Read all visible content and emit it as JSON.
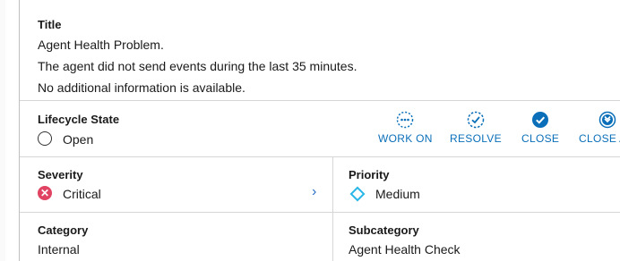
{
  "title_section": {
    "label": "Title",
    "lines": [
      "Agent Health Problem.",
      "The agent did not send events during the last 35 minutes.",
      "No additional information is available."
    ]
  },
  "lifecycle": {
    "label": "Lifecycle State",
    "value": "Open",
    "actions": [
      {
        "label": "WORK ON",
        "icon": "ellipsis-circle-icon"
      },
      {
        "label": "RESOLVE",
        "icon": "check-dashed-circle-icon"
      },
      {
        "label": "CLOSE",
        "icon": "check-filled-circle-icon"
      },
      {
        "label": "CLOSE A",
        "icon": "close-all-circle-icon"
      }
    ]
  },
  "severity": {
    "label": "Severity",
    "value": "Critical",
    "color": "#e04462"
  },
  "priority": {
    "label": "Priority",
    "value": "Medium",
    "color": "#29b6e8"
  },
  "category": {
    "label": "Category",
    "value": "Internal"
  },
  "subcategory": {
    "label": "Subcategory",
    "value": "Agent Health Check"
  },
  "colors": {
    "accent": "#0a6fb8"
  }
}
